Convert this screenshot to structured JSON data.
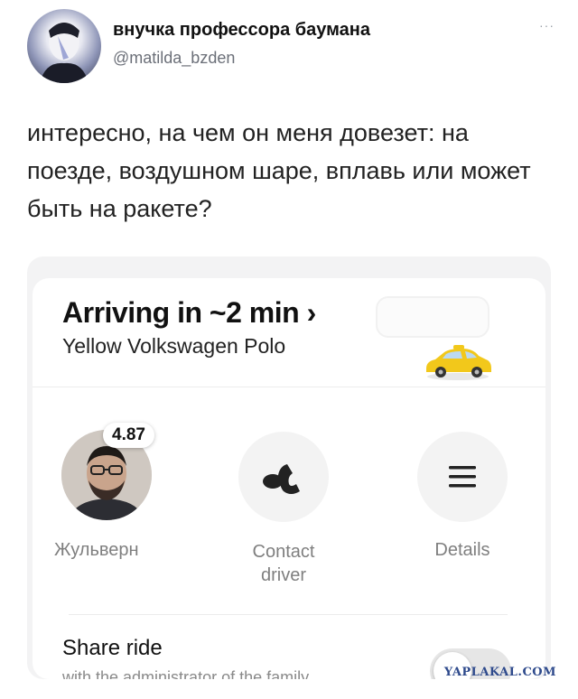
{
  "tweet": {
    "author_name": "внучка профессора баумана",
    "author_handle": "@matilda_bzden",
    "more_label": "···",
    "text": "интересно, на чем он меня довезет: на поезде, воздушном шаре, вплавь или может быть на ракете?"
  },
  "ride": {
    "arriving": "Arriving in ~2 min ›",
    "car_model": "Yellow Volkswagen Polo",
    "car_icon": "yellow-car-icon",
    "driver": {
      "rating": "4.87",
      "name": "Жульверн"
    },
    "contact_label": "Contact driver",
    "contact_icon": "phone-icon",
    "details_label": "Details",
    "details_icon": "hamburger-menu-icon",
    "share_title": "Share ride",
    "share_subtitle": "with the administrator of the family account",
    "share_enabled": false
  },
  "watermark": "YAPLAKAL.COM",
  "colors": {
    "car_yellow": "#f2c81b",
    "muted_text": "#7f7f7f",
    "watermark": "#2e4a8c"
  }
}
